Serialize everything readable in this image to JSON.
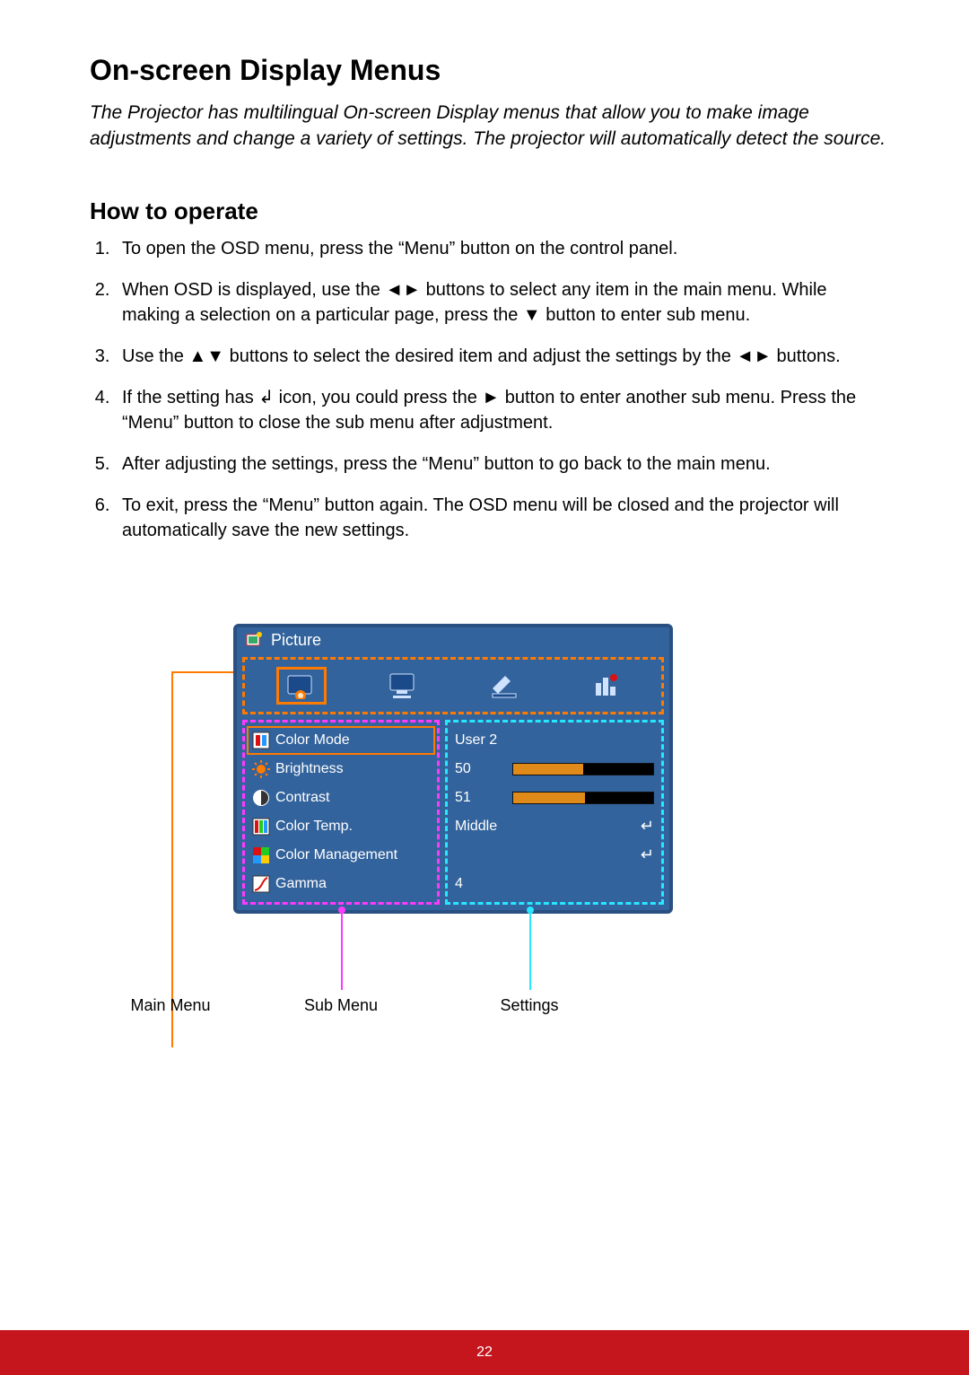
{
  "title": "On-screen Display Menus",
  "intro": "The Projector has multilingual On-screen Display menus that allow you to make image adjustments and change a variety of settings. The projector will automatically detect the source.",
  "howto_heading": "How to operate",
  "steps": [
    "To open the OSD menu, press the “Menu” button on the control panel.",
    "When OSD is displayed, use the ◄► buttons to select any item in the main menu. While making a selection on a particular page, press the ▼ button to enter sub menu.",
    "Use the ▲▼ buttons to select the desired item and adjust the settings by the ◄► buttons.",
    "If the setting has ↲ icon, you could press the ► button to enter another sub menu. Press the “Menu” button to close the sub menu after adjustment.",
    "After adjusting the settings, press the “Menu” button to go back to the main menu.",
    "To exit, press the “Menu” button again. The OSD menu will be closed and the projector will automatically save the new settings."
  ],
  "osd": {
    "title": "Picture",
    "tabs": [
      "picture",
      "screen",
      "setting",
      "option"
    ],
    "active_tab": 0,
    "items": [
      {
        "label": "Color Mode",
        "value": "User 2",
        "type": "text",
        "selected": true
      },
      {
        "label": "Brightness",
        "value": "50",
        "type": "bar",
        "fill": 50
      },
      {
        "label": "Contrast",
        "value": "51",
        "type": "bar",
        "fill": 51
      },
      {
        "label": "Color Temp.",
        "value": "Middle",
        "type": "enter"
      },
      {
        "label": "Color Management",
        "value": "",
        "type": "enter"
      },
      {
        "label": "Gamma",
        "value": "4",
        "type": "text"
      }
    ]
  },
  "callouts": {
    "main": "Main Menu",
    "sub": "Sub Menu",
    "settings": "Settings"
  },
  "page_number": "22"
}
